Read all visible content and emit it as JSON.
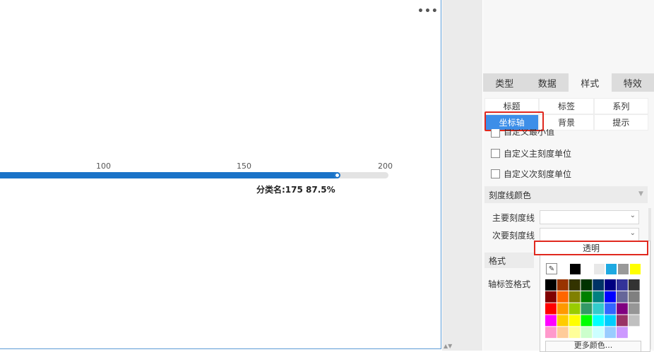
{
  "canvas": {
    "more_label": "•••",
    "ticks": [
      "100",
      "150",
      "200"
    ],
    "gauge": {
      "progress": 0.875,
      "label": "分类名:175 87.5%"
    }
  },
  "panel": {
    "tabs": [
      {
        "label": "类型"
      },
      {
        "label": "数据"
      },
      {
        "label": "样式",
        "active": true
      },
      {
        "label": "特效"
      }
    ],
    "subtabs": [
      {
        "label": "标题"
      },
      {
        "label": "标签"
      },
      {
        "label": "系列"
      },
      {
        "label": "坐标轴",
        "selected": true
      },
      {
        "label": "背景"
      },
      {
        "label": "提示"
      }
    ],
    "options": {
      "custom_min": "自定义最小值",
      "custom_major_unit": "自定义主刻度单位",
      "custom_minor_unit": "自定义次刻度单位"
    },
    "tick_color_section": "刻度线颜色",
    "major_tick_label": "主要刻度线",
    "minor_tick_label": "次要刻度线",
    "format_section": "格式",
    "axis_label_format": "轴标签格式"
  },
  "color_popup": {
    "transparent_label": "透明",
    "recent_colors": [
      "#000000",
      "#ffffff",
      "#e8e8e8",
      "#1ea9e1",
      "#999999",
      "#ffff00"
    ],
    "palette": [
      "#000000",
      "#993300",
      "#333300",
      "#003300",
      "#003366",
      "#000080",
      "#333399",
      "#333333",
      "#800000",
      "#ff6600",
      "#808000",
      "#008000",
      "#008080",
      "#0000ff",
      "#666699",
      "#808080",
      "#ff0000",
      "#ff9900",
      "#99cc00",
      "#339966",
      "#33cccc",
      "#3366ff",
      "#800080",
      "#969696",
      "#ff00ff",
      "#ffcc00",
      "#ffff00",
      "#00ff00",
      "#00ffff",
      "#00ccff",
      "#993366",
      "#c0c0c0",
      "#ff99cc",
      "#ffcc99",
      "#ffff99",
      "#ccffcc",
      "#ccffff",
      "#99ccff",
      "#cc99ff",
      "#ffffff"
    ],
    "more_colors_label": "更多颜色..."
  }
}
